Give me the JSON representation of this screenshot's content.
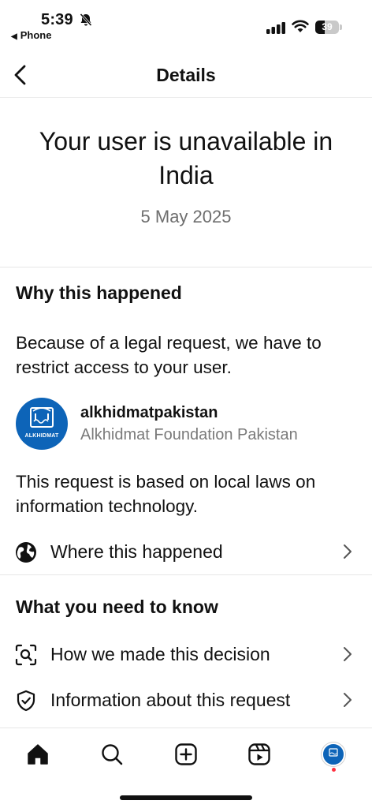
{
  "status_bar": {
    "time": "5:39",
    "back_app": "Phone",
    "battery_level": "39",
    "battery_fraction": 0.39
  },
  "header": {
    "title": "Details"
  },
  "hero": {
    "title": "Your user is unavailable in India",
    "date": "5 May 2025"
  },
  "why": {
    "heading": "Why this happened",
    "reason": "Because of a legal request, we have to restrict access to your user.",
    "requester": {
      "username": "alkhidmatpakistan",
      "display_name": "Alkhidmat Foundation Pakistan",
      "avatar_text": "ALKHIDMAT"
    },
    "basis": "This request is based on local laws on information technology.",
    "where_label": "Where this happened"
  },
  "know": {
    "heading": "What you need to know",
    "items": [
      {
        "label": "How we made this decision",
        "icon": "search-scan-icon"
      },
      {
        "label": "Information about this request",
        "icon": "shield-check-icon"
      }
    ]
  },
  "tabbar": {
    "items": [
      "home-icon",
      "search-icon",
      "create-icon",
      "reels-icon",
      "profile-avatar"
    ]
  },
  "colors": {
    "accent_blue": "#0d64b8",
    "notification_dot": "#ff3040",
    "secondary_text": "#6e6e6e"
  }
}
